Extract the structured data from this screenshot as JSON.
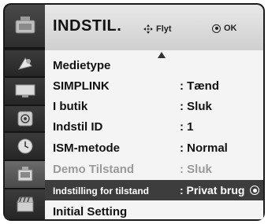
{
  "header": {
    "title": "INDSTIL.",
    "move_hint": "Flyt",
    "ok_hint": "OK"
  },
  "sidebar": {
    "icons": [
      "input-icon",
      "picture-icon",
      "audio-icon",
      "time-icon",
      "option-icon",
      "setup-icon"
    ]
  },
  "menu": {
    "items": [
      {
        "label": "Medietype",
        "value": ""
      },
      {
        "label": "SIMPLINK",
        "value": ": Tænd"
      },
      {
        "label": "I butik",
        "value": ": Sluk"
      },
      {
        "label": "Indstil ID",
        "value": ": 1"
      },
      {
        "label": "ISM-metode",
        "value": ": Normal"
      },
      {
        "label": "Demo Tilstand",
        "value": ": Sluk"
      },
      {
        "label": "Indstilling for tilstand",
        "value": ": Privat brug"
      },
      {
        "label": "Initial Setting",
        "value": ""
      }
    ]
  }
}
